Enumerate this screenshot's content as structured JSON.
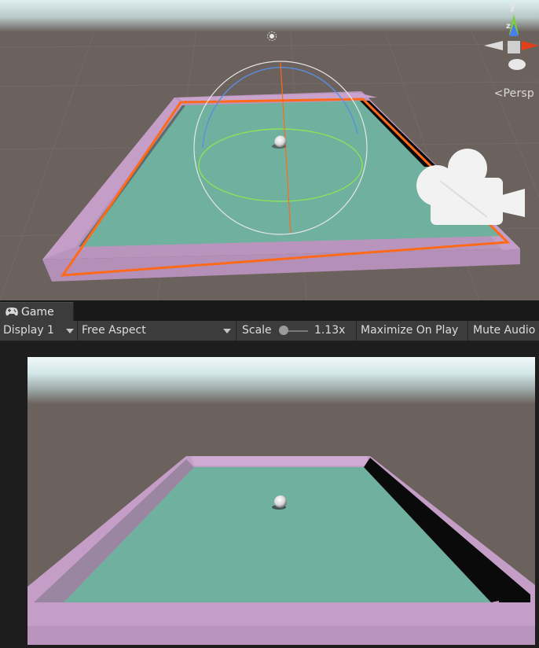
{
  "scene_view": {
    "projection_label": "Persp",
    "gizmo_axes": {
      "y": "y",
      "z": "z"
    },
    "icons": [
      "light-icon",
      "camera-icon",
      "scene-gizmo-icon"
    ]
  },
  "game_tab": {
    "label": "Game",
    "icon": "gamepad-icon"
  },
  "toolbar": {
    "display": "Display 1",
    "aspect": "Free Aspect",
    "scale_label": "Scale",
    "scale_value": "1.13x",
    "scale_fraction": 0.1,
    "maximize_on_play": "Maximize On Play",
    "mute_audio": "Mute Audio"
  },
  "colors": {
    "ground": "#6b615d",
    "sky": "#cfe3e6",
    "board_floor": "#6fb09e",
    "board_wall": "#c9a3cb",
    "selection_outline": "#ff6a1a",
    "panel_bg": "#3c3c3c",
    "game_bg": "#1d1d1d"
  }
}
